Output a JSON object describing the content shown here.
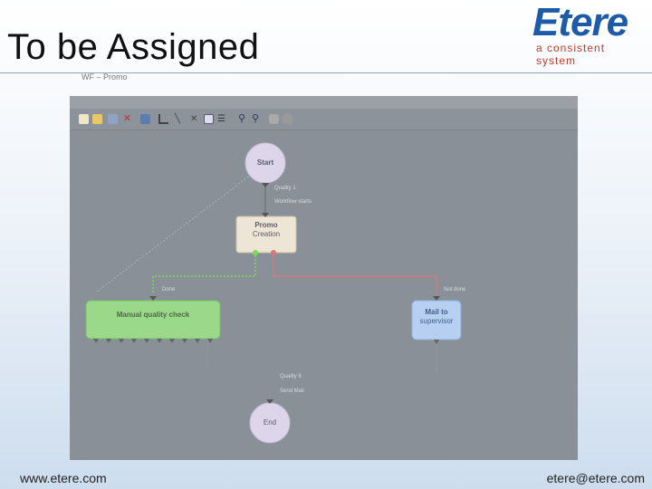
{
  "slide": {
    "title": "To be Assigned",
    "workflow_label": "WF – Promo"
  },
  "logo": {
    "word": "Etere",
    "tagline": "a consistent system"
  },
  "toolbar": {
    "buttons": [
      "new-icon",
      "open-icon",
      "save-icon",
      "delete-icon",
      "copy-icon",
      "connector-icon",
      "line-icon",
      "cross-icon",
      "node-icon",
      "text-icon",
      "zoom-in-icon",
      "zoom-out-icon",
      "settings-icon"
    ]
  },
  "workflow": {
    "nodes": {
      "start": "Start",
      "promo_line1": "Promo",
      "promo_line2": "Creation",
      "manual_quality": "Manual quality check",
      "mail_line1": "Mail to",
      "mail_line2": "supervisor",
      "end": "End"
    },
    "edge_labels": {
      "quality_1": "Quality 1",
      "workflow_starts": "Workflow starts",
      "done": "Done",
      "not_done": "Not done",
      "quality_9": "Quality 9",
      "send_mail": "Send Mail"
    },
    "colors": {
      "canvas": "#8a9097",
      "start_node": "#ddd5ea",
      "promo_node": "#ede6d6",
      "manual_node": "#9ad88a",
      "mail_node": "#b7d0f2",
      "done_edge": "#77dd55",
      "not_done_edge": "#dd7777"
    }
  },
  "footer": {
    "website": "www.etere.com",
    "email": "etere@etere.com"
  }
}
